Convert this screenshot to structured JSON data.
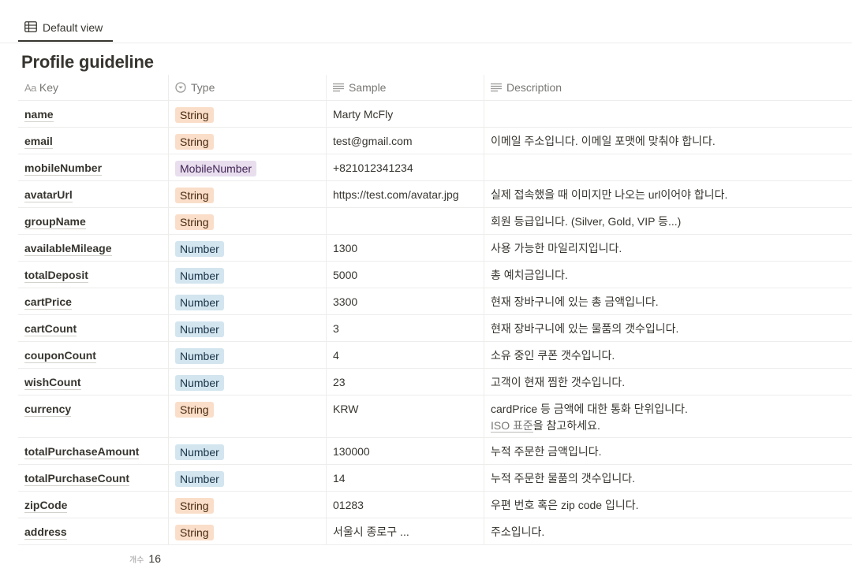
{
  "view_tab": {
    "label": "Default view",
    "icon": "table-icon"
  },
  "page_title": "Profile guideline",
  "columns": [
    {
      "label": "Key",
      "icon": "title-aa-icon",
      "icon_text": "Aa"
    },
    {
      "label": "Type",
      "icon": "select-icon"
    },
    {
      "label": "Sample",
      "icon": "text-lines-icon"
    },
    {
      "label": "Description",
      "icon": "text-lines-icon"
    }
  ],
  "type_colors": {
    "String": "#fadec9",
    "Number": "#d3e5ef",
    "MobileNumber": "#e8deee"
  },
  "rows": [
    {
      "key": "name",
      "type": "String",
      "sample": "Marty McFly",
      "description": ""
    },
    {
      "key": "email",
      "type": "String",
      "sample": "test@gmail.com",
      "description": "이메일 주소입니다. 이메일 포맷에 맞춰야 합니다."
    },
    {
      "key": "mobileNumber",
      "type": "MobileNumber",
      "sample": "+821012341234",
      "description": ""
    },
    {
      "key": "avatarUrl",
      "type": "String",
      "sample": "https://test.com/avatar.jpg",
      "description": "실제 접속했을 때 이미지만 나오는 url이어야 합니다."
    },
    {
      "key": "groupName",
      "type": "String",
      "sample": "",
      "description": "회원 등급입니다. (Silver, Gold, VIP 등...)"
    },
    {
      "key": "availableMileage",
      "type": "Number",
      "sample": "1300",
      "description": "사용 가능한 마일리지입니다."
    },
    {
      "key": "totalDeposit",
      "type": "Number",
      "sample": "5000",
      "description": "총 예치금입니다."
    },
    {
      "key": "cartPrice",
      "type": "Number",
      "sample": "3300",
      "description": "현재 장바구니에 있는 총 금액입니다."
    },
    {
      "key": "cartCount",
      "type": "Number",
      "sample": "3",
      "description": "현재 장바구니에 있는 물품의 갯수입니다."
    },
    {
      "key": "couponCount",
      "type": "Number",
      "sample": "4",
      "description": "소유 중인 쿠폰 갯수입니다."
    },
    {
      "key": "wishCount",
      "type": "Number",
      "sample": "23",
      "description": "고객이 현재 찜한 갯수입니다."
    },
    {
      "key": "currency",
      "type": "String",
      "sample": "KRW",
      "description": "cardPrice 등 금액에 대한 통화 단위입니다.",
      "description_link": "ISO 표준",
      "description_suffix": "을 참고하세요."
    },
    {
      "key": "totalPurchaseAmount",
      "type": "Number",
      "sample": "130000",
      "description": "누적 주문한 금액입니다."
    },
    {
      "key": "totalPurchaseCount",
      "type": "Number",
      "sample": "14",
      "description": "누적 주문한 물품의 갯수입니다."
    },
    {
      "key": "zipCode",
      "type": "String",
      "sample": "01283",
      "description": "우편 번호 혹은 zip code 입니다."
    },
    {
      "key": "address",
      "type": "String",
      "sample": "서울시 종로구 ...",
      "description": "주소입니다."
    }
  ],
  "footer": {
    "count_label": "개수",
    "count_value": "16"
  }
}
